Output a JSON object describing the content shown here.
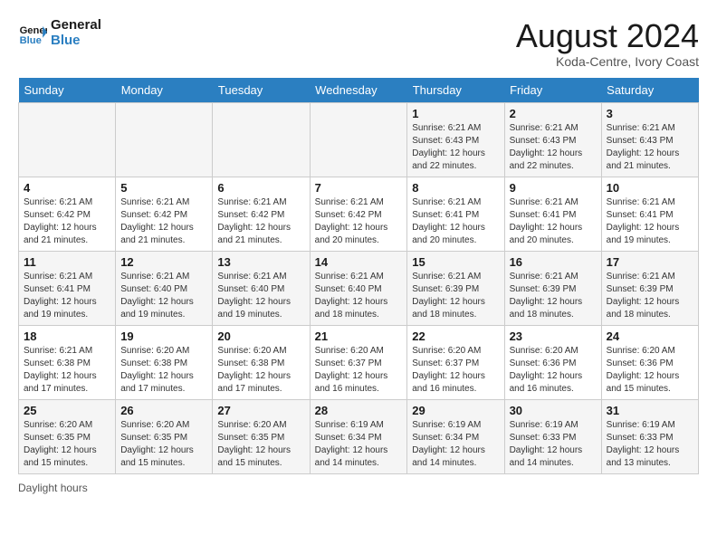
{
  "header": {
    "logo_text_general": "General",
    "logo_text_blue": "Blue",
    "month_year": "August 2024",
    "location": "Koda-Centre, Ivory Coast"
  },
  "days_of_week": [
    "Sunday",
    "Monday",
    "Tuesday",
    "Wednesday",
    "Thursday",
    "Friday",
    "Saturday"
  ],
  "weeks": [
    [
      {
        "day": "",
        "info": ""
      },
      {
        "day": "",
        "info": ""
      },
      {
        "day": "",
        "info": ""
      },
      {
        "day": "",
        "info": ""
      },
      {
        "day": "1",
        "info": "Sunrise: 6:21 AM\nSunset: 6:43 PM\nDaylight: 12 hours and 22 minutes."
      },
      {
        "day": "2",
        "info": "Sunrise: 6:21 AM\nSunset: 6:43 PM\nDaylight: 12 hours and 22 minutes."
      },
      {
        "day": "3",
        "info": "Sunrise: 6:21 AM\nSunset: 6:43 PM\nDaylight: 12 hours and 21 minutes."
      }
    ],
    [
      {
        "day": "4",
        "info": "Sunrise: 6:21 AM\nSunset: 6:42 PM\nDaylight: 12 hours and 21 minutes."
      },
      {
        "day": "5",
        "info": "Sunrise: 6:21 AM\nSunset: 6:42 PM\nDaylight: 12 hours and 21 minutes."
      },
      {
        "day": "6",
        "info": "Sunrise: 6:21 AM\nSunset: 6:42 PM\nDaylight: 12 hours and 21 minutes."
      },
      {
        "day": "7",
        "info": "Sunrise: 6:21 AM\nSunset: 6:42 PM\nDaylight: 12 hours and 20 minutes."
      },
      {
        "day": "8",
        "info": "Sunrise: 6:21 AM\nSunset: 6:41 PM\nDaylight: 12 hours and 20 minutes."
      },
      {
        "day": "9",
        "info": "Sunrise: 6:21 AM\nSunset: 6:41 PM\nDaylight: 12 hours and 20 minutes."
      },
      {
        "day": "10",
        "info": "Sunrise: 6:21 AM\nSunset: 6:41 PM\nDaylight: 12 hours and 19 minutes."
      }
    ],
    [
      {
        "day": "11",
        "info": "Sunrise: 6:21 AM\nSunset: 6:41 PM\nDaylight: 12 hours and 19 minutes."
      },
      {
        "day": "12",
        "info": "Sunrise: 6:21 AM\nSunset: 6:40 PM\nDaylight: 12 hours and 19 minutes."
      },
      {
        "day": "13",
        "info": "Sunrise: 6:21 AM\nSunset: 6:40 PM\nDaylight: 12 hours and 19 minutes."
      },
      {
        "day": "14",
        "info": "Sunrise: 6:21 AM\nSunset: 6:40 PM\nDaylight: 12 hours and 18 minutes."
      },
      {
        "day": "15",
        "info": "Sunrise: 6:21 AM\nSunset: 6:39 PM\nDaylight: 12 hours and 18 minutes."
      },
      {
        "day": "16",
        "info": "Sunrise: 6:21 AM\nSunset: 6:39 PM\nDaylight: 12 hours and 18 minutes."
      },
      {
        "day": "17",
        "info": "Sunrise: 6:21 AM\nSunset: 6:39 PM\nDaylight: 12 hours and 18 minutes."
      }
    ],
    [
      {
        "day": "18",
        "info": "Sunrise: 6:21 AM\nSunset: 6:38 PM\nDaylight: 12 hours and 17 minutes."
      },
      {
        "day": "19",
        "info": "Sunrise: 6:20 AM\nSunset: 6:38 PM\nDaylight: 12 hours and 17 minutes."
      },
      {
        "day": "20",
        "info": "Sunrise: 6:20 AM\nSunset: 6:38 PM\nDaylight: 12 hours and 17 minutes."
      },
      {
        "day": "21",
        "info": "Sunrise: 6:20 AM\nSunset: 6:37 PM\nDaylight: 12 hours and 16 minutes."
      },
      {
        "day": "22",
        "info": "Sunrise: 6:20 AM\nSunset: 6:37 PM\nDaylight: 12 hours and 16 minutes."
      },
      {
        "day": "23",
        "info": "Sunrise: 6:20 AM\nSunset: 6:36 PM\nDaylight: 12 hours and 16 minutes."
      },
      {
        "day": "24",
        "info": "Sunrise: 6:20 AM\nSunset: 6:36 PM\nDaylight: 12 hours and 15 minutes."
      }
    ],
    [
      {
        "day": "25",
        "info": "Sunrise: 6:20 AM\nSunset: 6:35 PM\nDaylight: 12 hours and 15 minutes."
      },
      {
        "day": "26",
        "info": "Sunrise: 6:20 AM\nSunset: 6:35 PM\nDaylight: 12 hours and 15 minutes."
      },
      {
        "day": "27",
        "info": "Sunrise: 6:20 AM\nSunset: 6:35 PM\nDaylight: 12 hours and 15 minutes."
      },
      {
        "day": "28",
        "info": "Sunrise: 6:19 AM\nSunset: 6:34 PM\nDaylight: 12 hours and 14 minutes."
      },
      {
        "day": "29",
        "info": "Sunrise: 6:19 AM\nSunset: 6:34 PM\nDaylight: 12 hours and 14 minutes."
      },
      {
        "day": "30",
        "info": "Sunrise: 6:19 AM\nSunset: 6:33 PM\nDaylight: 12 hours and 14 minutes."
      },
      {
        "day": "31",
        "info": "Sunrise: 6:19 AM\nSunset: 6:33 PM\nDaylight: 12 hours and 13 minutes."
      }
    ]
  ],
  "footer": {
    "daylight_label": "Daylight hours"
  }
}
